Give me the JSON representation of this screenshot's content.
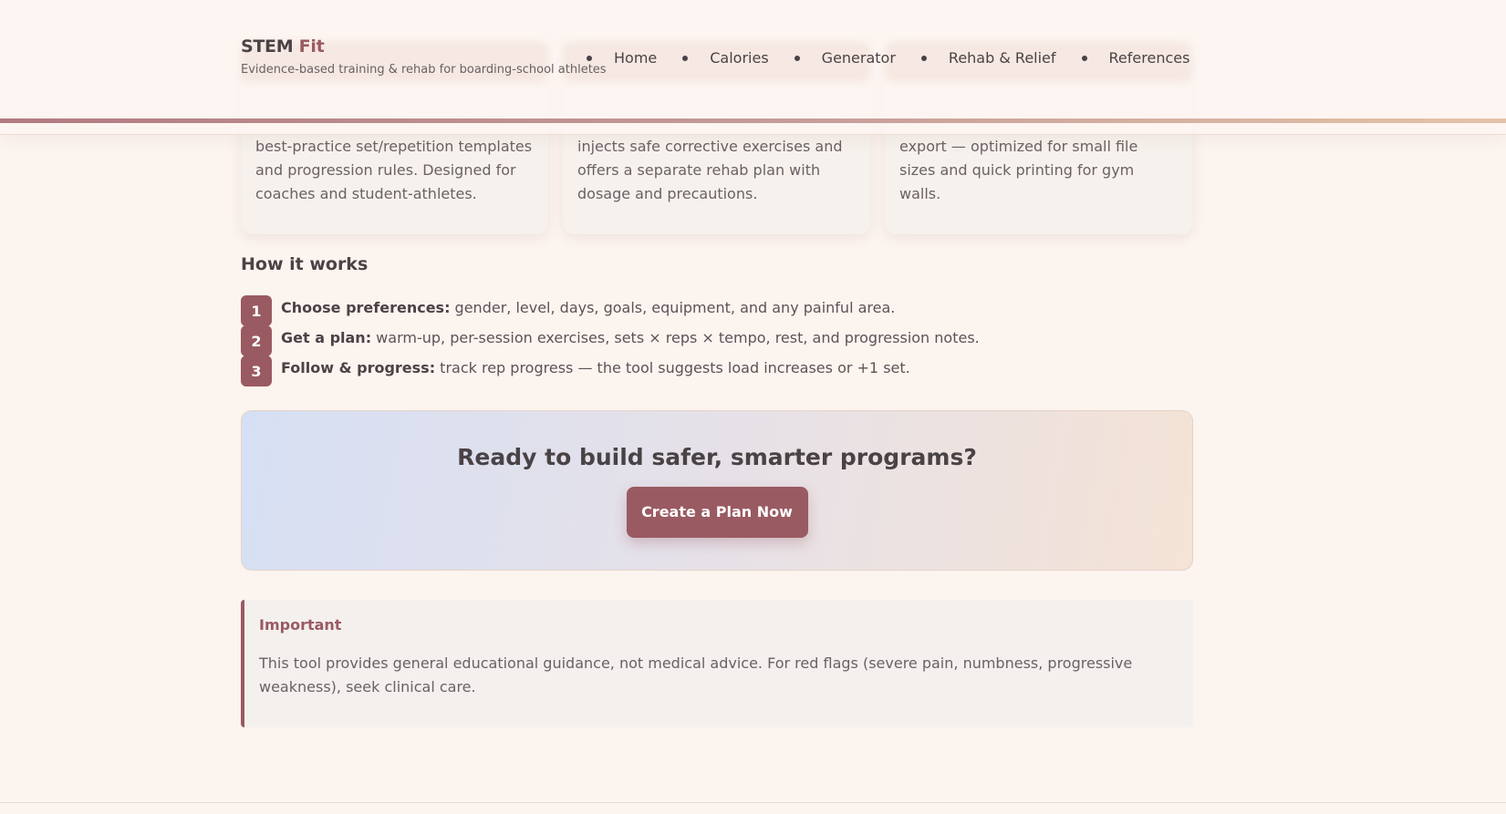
{
  "header": {
    "brand_main": "STEM",
    "brand_accent": "Fit",
    "tagline": "Evidence-based training & rehab for boarding-school athletes",
    "nav": [
      {
        "label": "Home"
      },
      {
        "label": "Calories"
      },
      {
        "label": "Generator"
      },
      {
        "label": "Rehab & Relief"
      },
      {
        "label": "References"
      }
    ]
  },
  "cards": [
    {
      "text": "best-practice set/repetition templates and progression rules. Designed for coaches and student-athletes."
    },
    {
      "text": "injects safe corrective exercises and offers a separate rehab plan with dosage and precautions."
    },
    {
      "text": "export — optimized for small file sizes and quick printing for gym walls."
    }
  ],
  "how_it_works": {
    "title": "How it works",
    "steps": [
      {
        "num": "1",
        "bold": "Choose preferences:",
        "text": " gender, level, days, goals, equipment, and any painful area."
      },
      {
        "num": "2",
        "bold": "Get a plan:",
        "text": " warm-up, per-session exercises, sets × reps × tempo, rest, and progression notes."
      },
      {
        "num": "3",
        "bold": "Follow & progress:",
        "text": " track rep progress — the tool suggests load increases or +1 set."
      }
    ]
  },
  "cta": {
    "title": "Ready to build safer, smarter programs?",
    "button_label": "Create a Plan Now"
  },
  "notice": {
    "title": "Important",
    "text": "This tool provides general educational guidance, not medical advice. For red flags (severe pain, numbness, progressive weakness), seek clinical care."
  },
  "colors": {
    "accent": "#9a5a62",
    "background": "#fcf4ef",
    "text": "#4a4346"
  }
}
